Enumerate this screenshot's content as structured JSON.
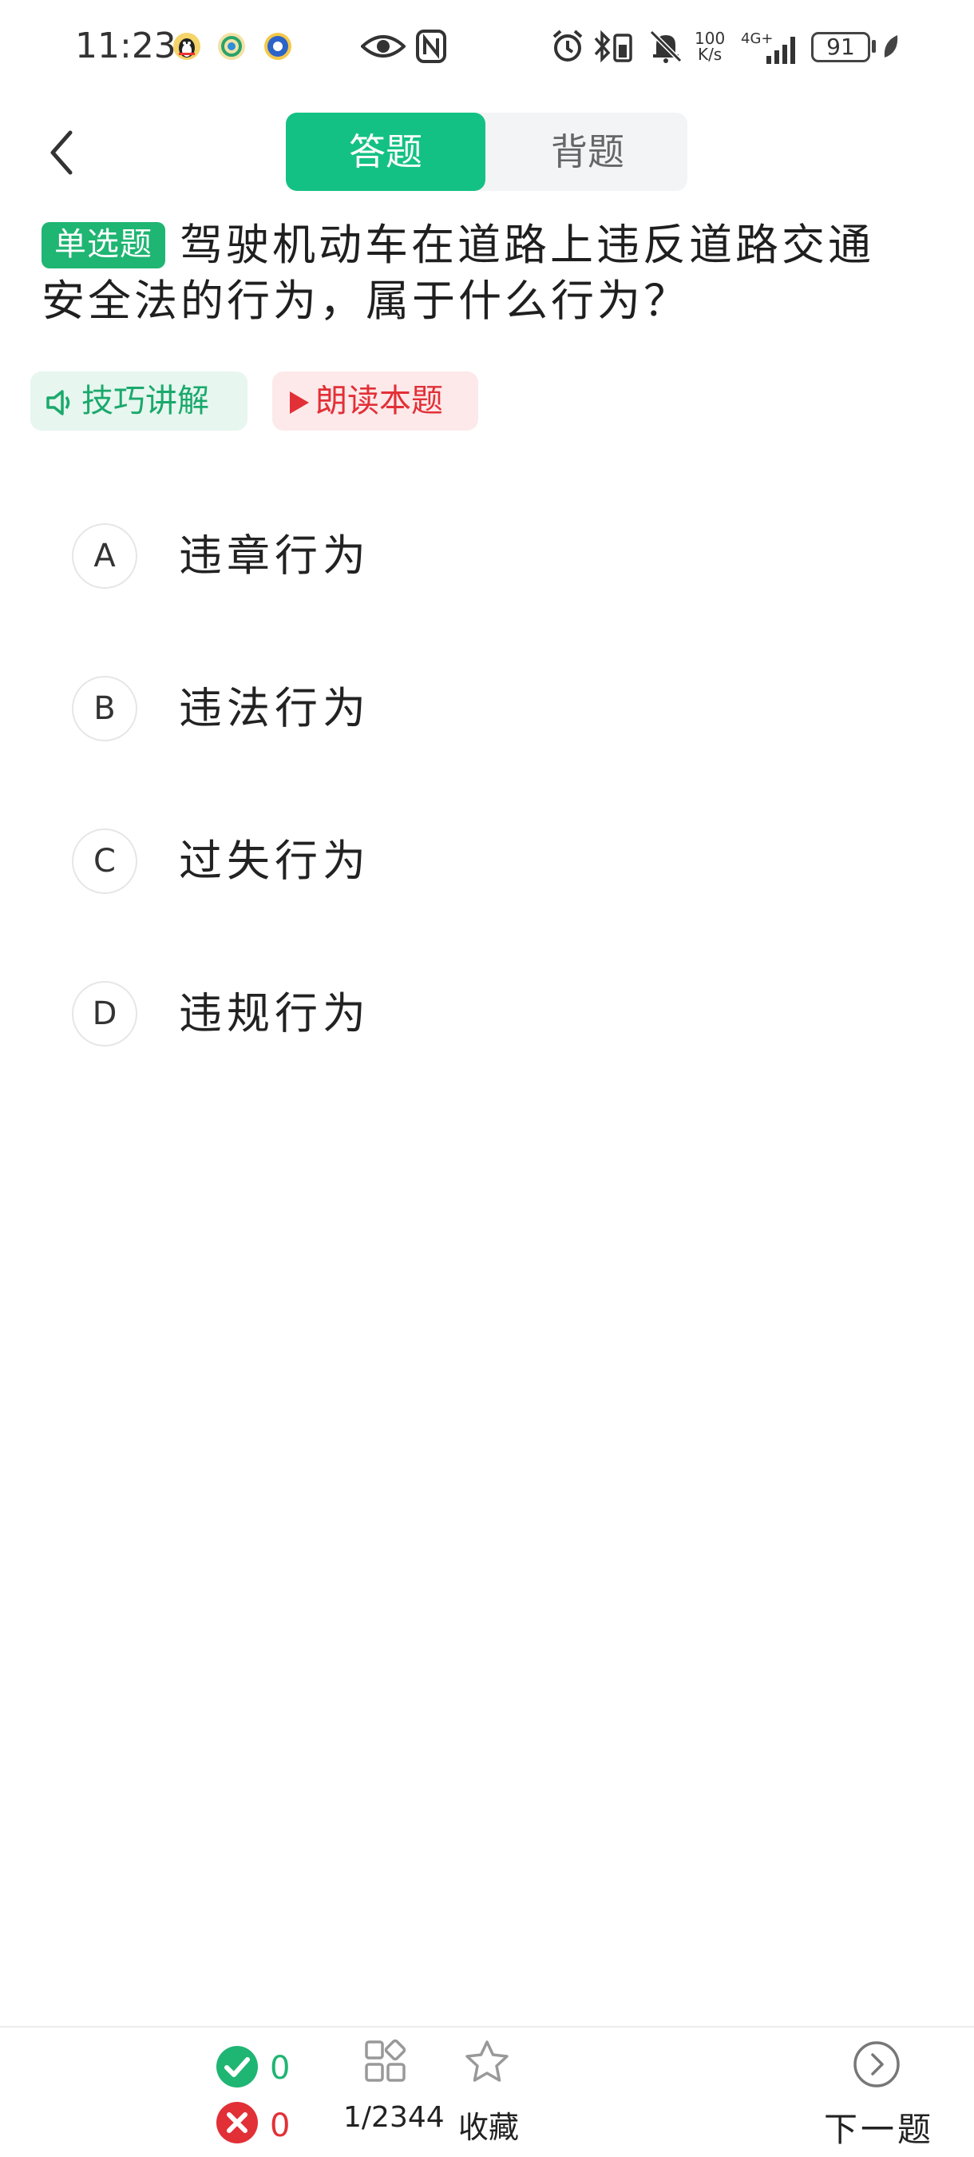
{
  "status_bar": {
    "time": "11:23",
    "net_speed_value": "100",
    "net_speed_unit": "K/s",
    "network": "4G+",
    "battery": "91"
  },
  "header": {
    "tabs": [
      {
        "label": "答题",
        "active": true
      },
      {
        "label": "背题",
        "active": false
      }
    ]
  },
  "question": {
    "type_badge": "单选题",
    "text": "驾驶机动车在道路上违反道路交通安全法的行为，属于什么行为？"
  },
  "actions": {
    "tips_label": "技巧讲解",
    "read_label": "朗读本题"
  },
  "options": [
    {
      "letter": "A",
      "text": "违章行为"
    },
    {
      "letter": "B",
      "text": "违法行为"
    },
    {
      "letter": "C",
      "text": "过失行为"
    },
    {
      "letter": "D",
      "text": "违规行为"
    }
  ],
  "footer": {
    "correct_count": "0",
    "wrong_count": "0",
    "progress": "1/2344",
    "favorite_label": "收藏",
    "next_label": "下一题"
  },
  "colors": {
    "accent_green": "#14c184",
    "correct_green": "#1fb572",
    "wrong_red": "#e23037"
  }
}
